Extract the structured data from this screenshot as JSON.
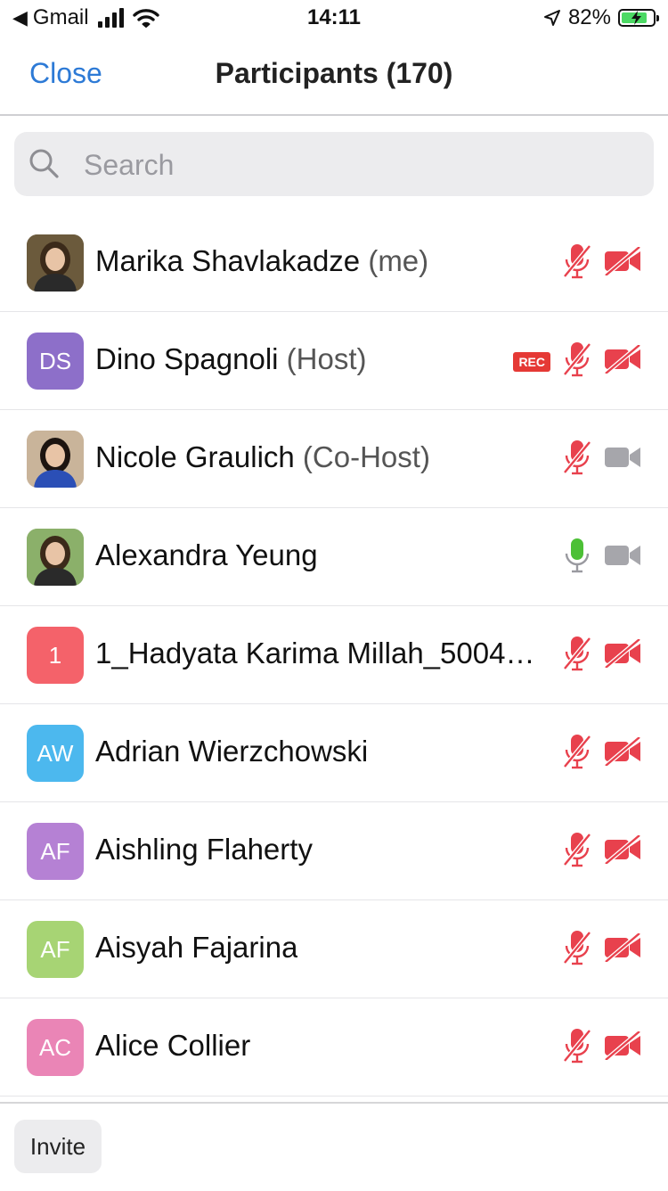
{
  "status_bar": {
    "back_app": "Gmail",
    "time": "14:11",
    "battery_pct": "82%",
    "battery_level": 0.82
  },
  "nav": {
    "close_label": "Close",
    "title": "Participants (170)"
  },
  "search": {
    "placeholder": "Search"
  },
  "participants": [
    {
      "name": "Marika Shavlakadze",
      "role": "(me)",
      "initials": "",
      "avatar_type": "photo",
      "avatar_color": "#6b5a3c",
      "mic": "muted",
      "video": "off",
      "rec": ""
    },
    {
      "name": "Dino Spagnoli",
      "role": "(Host)",
      "initials": "DS",
      "avatar_type": "initials",
      "avatar_color": "#8d6fc9",
      "mic": "muted",
      "video": "off",
      "rec": "REC"
    },
    {
      "name": "Nicole Graulich",
      "role": "(Co-Host)",
      "initials": "",
      "avatar_type": "photo",
      "avatar_color": "#c9b49a",
      "mic": "muted",
      "video": "on",
      "rec": ""
    },
    {
      "name": "Alexandra Yeung",
      "role": "",
      "initials": "",
      "avatar_type": "photo",
      "avatar_color": "#8bb06a",
      "mic": "active",
      "video": "on",
      "rec": ""
    },
    {
      "name": "1_Hadyata Karima Millah_50042...",
      "role": "",
      "initials": "1",
      "avatar_type": "initials",
      "avatar_color": "#f4626a",
      "mic": "muted",
      "video": "off",
      "rec": ""
    },
    {
      "name": "Adrian Wierzchowski",
      "role": "",
      "initials": "AW",
      "avatar_type": "initials",
      "avatar_color": "#4cb8ee",
      "mic": "muted",
      "video": "off",
      "rec": ""
    },
    {
      "name": "Aishling Flaherty",
      "role": "",
      "initials": "AF",
      "avatar_type": "initials",
      "avatar_color": "#b581d4",
      "mic": "muted",
      "video": "off",
      "rec": ""
    },
    {
      "name": "Aisyah Fajarina",
      "role": "",
      "initials": "AF",
      "avatar_type": "initials",
      "avatar_color": "#a7d474",
      "mic": "muted",
      "video": "off",
      "rec": ""
    },
    {
      "name": "Alice Collier",
      "role": "",
      "initials": "AC",
      "avatar_type": "initials",
      "avatar_color": "#ea85b6",
      "mic": "muted",
      "video": "off",
      "rec": ""
    }
  ],
  "bottom": {
    "invite_label": "Invite"
  },
  "colors": {
    "accent": "#2d7ad6",
    "muted_red": "#e8414d",
    "mic_active": "#4cc036",
    "video_on_gray": "#a6a6ab"
  },
  "icons": {
    "mic_muted": "mic-muted-icon",
    "mic_active": "mic-icon",
    "video_off": "video-off-icon",
    "video_on": "video-icon"
  }
}
